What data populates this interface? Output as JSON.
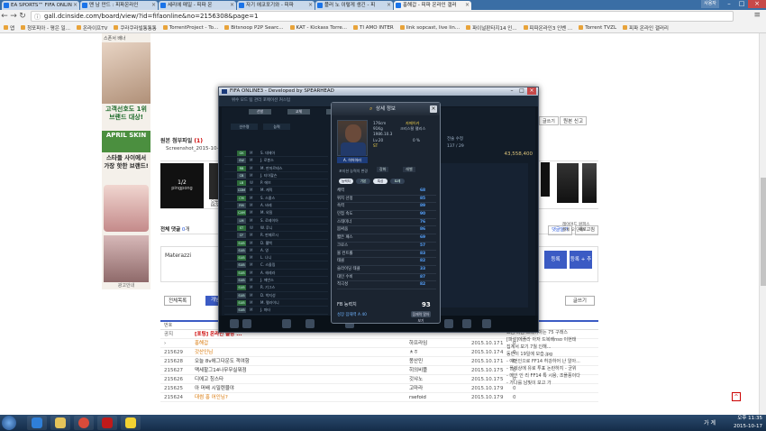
{
  "browser": {
    "tabs": [
      {
        "label": "EA SPORTS™ FIFA ONLIN"
      },
      {
        "label": "맨 남 만드 : 피파온라인"
      },
      {
        "label": "세리에 매일 - 피파 온"
      },
      {
        "label": "자기 에코포기와 - 피파"
      },
      {
        "label": "플러 노 이렇게 생긴 - 피"
      },
      {
        "label": "홍해갑 - 피파 온라인 갤러",
        "active": true
      }
    ],
    "user_label": "사용자",
    "url": "gall.dcinside.com/board/view/?id=fifaonline&no=2156308&page=1",
    "bookmarks": [
      "앱",
      "청포피아 - 평은 일...",
      "온라이프TV",
      "쿠라쿠라빌통통통",
      "TorrentProject - To...",
      "Bitsnoop P2P Searc...",
      "KAT - Kickass Torre...",
      "TI AMO INTER",
      "link sopcast, live lin...",
      "파이널판타지14 인...",
      "피파온라인3 인벤 ...",
      "Torrent TVZL",
      "피파 온라인 갤러리"
    ]
  },
  "leftad": {
    "title": "스폰서 배너",
    "line1": "고객선호도 1위",
    "line2": "브랜드 대상!",
    "brand": "APRIL SKIN",
    "line3": "스타들 사이에서",
    "line4": "가장 핫한 브랜드!",
    "caption": "광고안내"
  },
  "post": {
    "attach_label": "원본 첨부파일",
    "attach_count": "(1)",
    "attach_file": "Screenshot_2015-10-...",
    "buttons": [
      "공유",
      "?",
      "원본 신고"
    ],
    "gallery_card_title": "1/2",
    "gallery_card_brand": "pingpong",
    "gallery_caps": [
      "오루",
      "BES",
      "레이어드 원피스",
      "퀄세 오 단화"
    ]
  },
  "comments": {
    "label": "전체 댓글",
    "count": "0",
    "count_unit": "개",
    "sort": "댓글달기",
    "refresh": "새로고침",
    "nick": "Materazzi",
    "btn1": "등록",
    "btn2": "등록 + 추천"
  },
  "listbar": {
    "all": "전체목록",
    "recommend": "개념글",
    "write": "글쓰기"
  },
  "table": {
    "head_no": "번호",
    "rows": [
      {
        "no": "공지",
        "subject": "[포팅] 온라인 물랑 ...",
        "author": "",
        "date": "",
        "hits": "",
        "rec": "",
        "type": "notice"
      },
      {
        "no": "›",
        "subject": "홍해갑",
        "author": "하프라임",
        "date": "2015.10.17",
        "hits": "1",
        "rec": "0",
        "type": "event"
      },
      {
        "no": "215629",
        "subject": "갓산인님",
        "author": "ㅊㅎ",
        "date": "2015.10.17",
        "hits": "4",
        "rec": "0",
        "type": "event"
      },
      {
        "no": "215628",
        "subject": "오늘 8v에그다운도 객여함",
        "author": "몽산민",
        "date": "2015.10.17",
        "hits": "1",
        "rec": "0",
        "type": ""
      },
      {
        "no": "215627",
        "subject": "맥세할그14나무무실뭐점",
        "author": "히의비플",
        "date": "2015.10.17",
        "hits": "5",
        "rec": "0",
        "type": ""
      },
      {
        "no": "215626",
        "subject": "디에고 칭스타",
        "author": "갓샤노",
        "date": "2015.10.17",
        "hits": "5",
        "rec": "0",
        "type": ""
      },
      {
        "no": "215625",
        "subject": "아 머배 시밀렌뮬야",
        "author": "고마라",
        "date": "2015.10.17",
        "hits": "9",
        "rec": "0",
        "type": ""
      },
      {
        "no": "215624",
        "subject": "대썸 홍 어인님?",
        "author": "rsefoid",
        "date": "2015.10.17",
        "hits": "9",
        "rec": "0",
        "type": "event"
      }
    ]
  },
  "rightside": {
    "btn_write": "글쓰기",
    "btn_scroll": "원본 신고",
    "cap1": "레이어드 원피스",
    "cap2": "퀄세 오 단화",
    "side_title": "월간 베스트",
    "side_title2": "[지시 구별게시판]",
    "side_items": [
      "요즘 더움 그레이아는 75 구래스",
      "[파설]에플라 아저 드복배nso 이현태",
      "집계서 보기 7월 인해...",
      "동민이 19일에 모습.jpg",
      "- 예언인으로 FF14 허강하어 난 알아...",
      "- 플레상에 유로 투표 논란하지 - 균위",
      "- 메인 인 리 FF14 특 시용, 조플풍이다",
      "- 가나를 남빛이 보고 가"
    ]
  },
  "game": {
    "title": "FIFA ONLINE3 - Developed by SPEARHEAD",
    "nav": "위수 모드   팀 관리   포메이션   커스텀",
    "fields": [
      "선발",
      "교체",
      "리저"
    ],
    "tabs": [
      "선수명",
      "능력"
    ],
    "money": "43,558,400",
    "stats": [
      "전술 수정",
      "137 / 29"
    ],
    "players": [
      {
        "pos": "GK",
        "ab": "M",
        "name": "S. 데헤아"
      },
      {
        "pos": "SW",
        "ab": "M",
        "name": "J. 로봉스"
      },
      {
        "pos": "RB",
        "ab": "M",
        "name": "M. 판마르테스"
      },
      {
        "pos": "CB",
        "ab": "M",
        "name": "J. 티아왈슨"
      },
      {
        "pos": "LB",
        "ab": "W",
        "name": "P. 에브"
      },
      {
        "pos": "CDM",
        "ab": "M",
        "name": "M. 캐릭"
      },
      {
        "pos": "CM",
        "ab": "M",
        "name": "S. 스콜스"
      },
      {
        "pos": "RM",
        "ab": "M",
        "name": "A. 바레"
      },
      {
        "pos": "CAM",
        "ab": "M",
        "name": "M. 외질"
      },
      {
        "pos": "LM",
        "ab": "M",
        "name": "S. 로레이아"
      },
      {
        "pos": "ST",
        "ab": "W",
        "name": "W. 루니"
      },
      {
        "pos": "CF",
        "ab": "M",
        "name": "R. 판페르시"
      },
      {
        "pos": "SUB",
        "ab": "M",
        "name": "D. 웰백"
      },
      {
        "pos": "SUB",
        "ab": "M",
        "name": "A. 영"
      },
      {
        "pos": "SUB",
        "ab": "M",
        "name": "L. 나니"
      },
      {
        "pos": "SUB",
        "ab": "M",
        "name": "C. 스몰링"
      },
      {
        "pos": "SUB",
        "ab": "M",
        "name": "A. 헤레라"
      },
      {
        "pos": "SUB",
        "ab": "M",
        "name": "J. 에반스"
      },
      {
        "pos": "SUB",
        "ab": "M",
        "name": "R. 기그스"
      },
      {
        "pos": "SUB",
        "ab": "M",
        "name": "D. 박지성"
      },
      {
        "pos": "SUB",
        "ab": "M",
        "name": "M. 펠라이니"
      },
      {
        "pos": "SUB",
        "ab": "M",
        "name": "J. 마타"
      }
    ]
  },
  "dialog": {
    "title": "상세 정보",
    "player_name": "A. 히어아러",
    "info": [
      "176cm",
      "91Kg",
      "1986.10.3",
      "Lv.20"
    ],
    "info_right": [
      "자메이카",
      "크리스탈 팰리스",
      "",
      "0 %"
    ],
    "club_pos": "ST",
    "select_label": "포지션 능력치 변경",
    "select_values": [
      "강화",
      "레벨"
    ],
    "tabs": [
      "능력치",
      "기본",
      "특성",
      "트레"
    ],
    "stats": [
      {
        "label": "체력",
        "value": "68"
      },
      {
        "label": "위치 선정",
        "value": "85"
      },
      {
        "label": "속력",
        "value": "89"
      },
      {
        "label": "민첩 속도",
        "value": "90"
      },
      {
        "label": "스태미너",
        "value": "76"
      },
      {
        "label": "몸싸움",
        "value": "86"
      },
      {
        "label": "짧은 패스",
        "value": "69"
      },
      {
        "label": "크로스",
        "value": "57"
      },
      {
        "label": "볼 컨트롤",
        "value": "83"
      },
      {
        "label": "태클",
        "value": "82"
      },
      {
        "label": "슬라이딩 태클",
        "value": "33"
      },
      {
        "label": "대인 수비",
        "value": "87"
      },
      {
        "label": "적극성",
        "value": "82"
      }
    ],
    "ovr_label": "FB 능력치",
    "ovr_value": "93",
    "potential": "성장 잠재력 A 40",
    "potential_btn": "잠재력 알아보기"
  },
  "taskbar": {
    "ime": "가 계",
    "time": "오후 11:35",
    "date": "2015-10-17"
  },
  "colors": {
    "accent": "#3b5bc4",
    "notice": "#cc0000",
    "stat_blue": "#56a3ff"
  }
}
